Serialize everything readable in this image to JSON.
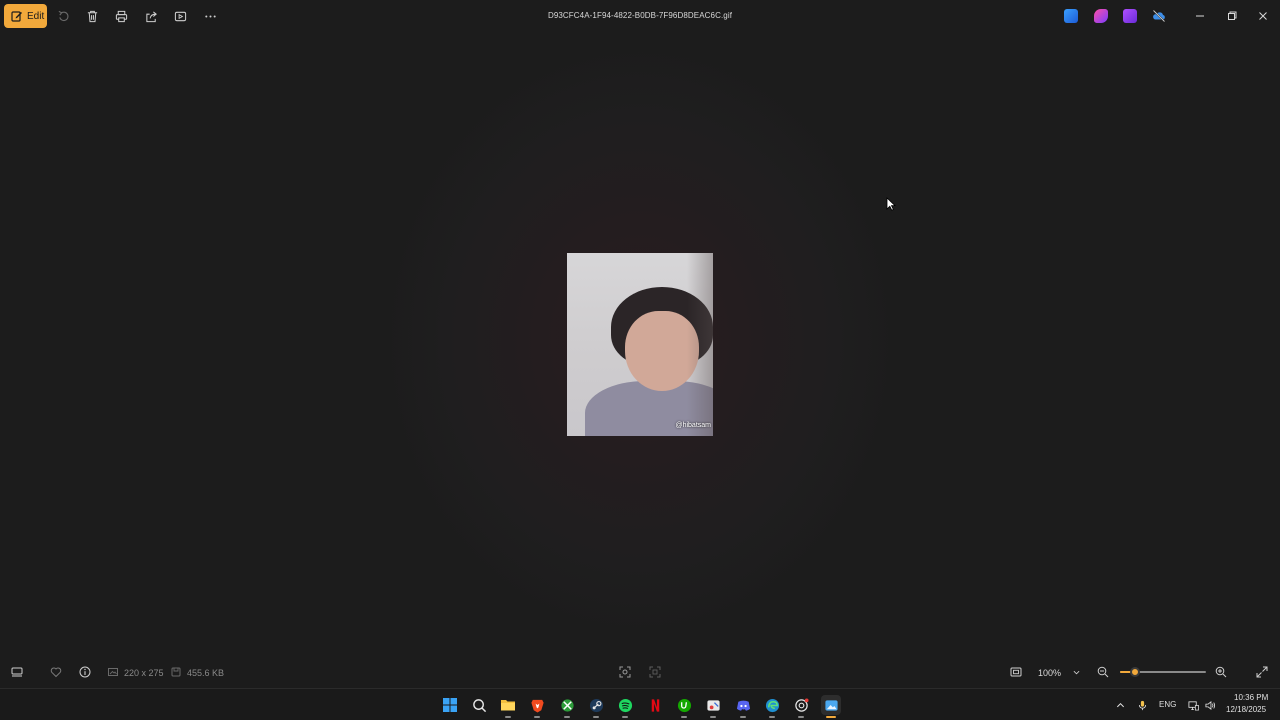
{
  "toolbar": {
    "edit_label": "Edit",
    "icons": [
      "rotate-icon",
      "delete-icon",
      "print-icon",
      "share-icon",
      "slideshow-icon",
      "more-icon"
    ]
  },
  "window": {
    "title": "D93CFC4A-1F94-4822-B0DB-7F96D8DEAC6C.gif",
    "app_icons": [
      "designer-icon",
      "clipchamp-icon",
      "video-editor-icon",
      "onedrive-icon"
    ],
    "controls": [
      "minimize-icon",
      "restore-icon",
      "close-icon"
    ]
  },
  "image": {
    "watermark": "@hibatsam"
  },
  "statusbar": {
    "dimensions": "220 x 275",
    "file_size": "455.6 KB",
    "zoom": "100%",
    "zoom_fraction": 0.17
  },
  "taskbar": {
    "apps": [
      "start",
      "search",
      "file-explorer",
      "brave",
      "xbox",
      "steam",
      "spotify",
      "netflix",
      "upwork",
      "snipping-tool",
      "discord",
      "edge",
      "chatgpt",
      "photos"
    ],
    "language": "ENG",
    "time": "10:36 PM",
    "date": "12/18/2025"
  },
  "colors": {
    "accent": "#f2a93b",
    "background": "#1c1c1c"
  }
}
